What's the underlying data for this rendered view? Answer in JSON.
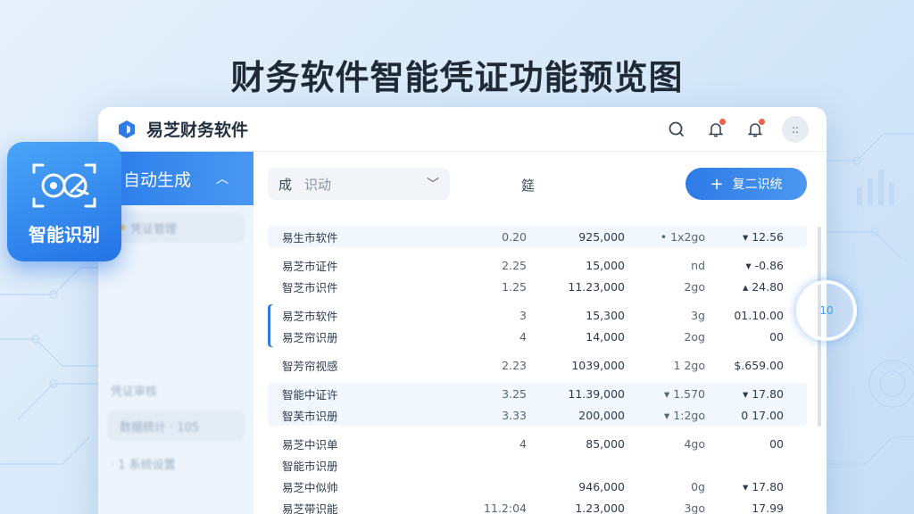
{
  "headline": "财务软件智能凭证功能预览图",
  "app": {
    "title": "易芝财务软件"
  },
  "topbar": {
    "avatar_text": "::"
  },
  "sidebar": {
    "active_label": "自动生成",
    "items": [
      {
        "label": "凭证管理"
      },
      {
        "label": "凭证审核"
      },
      {
        "label": "数据统计 · 105"
      },
      {
        "label": "· 1 系统设置"
      }
    ],
    "smart_card_label": "智能识别"
  },
  "toolbar": {
    "filter_label": "成",
    "filter_value": "识动",
    "middle_label": "筵",
    "primary_button": "复二识统"
  },
  "table": {
    "groups": [
      {
        "style": "hl",
        "rows": [
          {
            "name": "易生市软件",
            "a": "0.20",
            "b": "925,000",
            "c": "• 1x2go",
            "d": "▾ 12.56"
          }
        ]
      },
      {
        "style": "",
        "rows": [
          {
            "name": "易芝市证件",
            "a": "2.25",
            "b": "15,000",
            "c": "nd",
            "d": "▾ -0.86"
          },
          {
            "name": "智芝市识件",
            "a": "1.25",
            "b": "11.23,000",
            "c": "2go",
            "d": "▴ 24.80"
          }
        ]
      },
      {
        "style": "sel",
        "rows": [
          {
            "name": "易芝市软件",
            "a": "3",
            "b": "15,300",
            "c": "3g",
            "d": "01.10.00"
          },
          {
            "name": "易芝帘识册",
            "a": "4",
            "b": "14,000",
            "c": "2og",
            "d": "00"
          }
        ]
      },
      {
        "style": "",
        "rows": [
          {
            "name": "智芳帘视感",
            "a": "2.23",
            "b": "1039,000",
            "c": "1 2go",
            "d": "$.659.00"
          }
        ]
      },
      {
        "style": "hl",
        "rows": [
          {
            "name": "智能中证许",
            "a": "3.25",
            "b": "11.39,000",
            "c": "▾ 1.570",
            "d": "▾ 17.80"
          },
          {
            "name": "智芙市识册",
            "a": "3.33",
            "b": "200,000",
            "c": "▾ 1:2go",
            "d": "0  17.00"
          }
        ]
      },
      {
        "style": "",
        "rows": [
          {
            "name": "易芝中识单",
            "a": "4",
            "b": "85,000",
            "c": "4go",
            "d": "00"
          },
          {
            "name": "智能市识册",
            "a": "",
            "b": "",
            "c": "",
            "d": ""
          },
          {
            "name": "易芝中似帅",
            "a": "",
            "b": "946,000",
            "c": "0g",
            "d": "▾ 17.80"
          },
          {
            "name": "易芝带识能",
            "a": "11.2:04",
            "b": "1.23,000",
            "c": "3go",
            "d": "17.99"
          }
        ]
      }
    ]
  },
  "scroll_indicator": "10",
  "colors": {
    "accent": "#2e7ae6",
    "alert_dot": "#f0604a",
    "headline": "#1f2a36"
  }
}
